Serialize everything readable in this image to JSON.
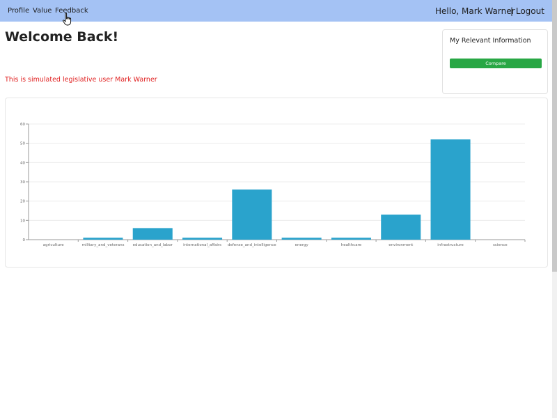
{
  "nav": {
    "links": [
      "Profile",
      "Value",
      "Feedback"
    ],
    "greeting": "Hello, Mark Warner",
    "logout": "| Logout"
  },
  "main": {
    "title": "Welcome Back!",
    "notice": "This is simulated legislative user Mark Warner"
  },
  "info_card": {
    "title": "My Relevant Information",
    "compare_label": "Compare"
  },
  "colors": {
    "navbar": "#a4c2f4",
    "bar": "#2aa3cc",
    "notice": "#e02020",
    "compare_button": "#28a745"
  },
  "chart_data": {
    "type": "bar",
    "categories": [
      "agriculture",
      "military_and_veterans",
      "education_and_labor",
      "international_affairs",
      "defense_and_intelligence",
      "energy",
      "healthcare",
      "environment",
      "infrastructure",
      "science"
    ],
    "values": [
      0,
      1,
      6,
      1,
      26,
      1,
      1,
      13,
      52,
      0
    ],
    "yticks": [
      0,
      10,
      20,
      30,
      40,
      50,
      60
    ],
    "ylim": [
      0,
      60
    ],
    "grid": true
  }
}
